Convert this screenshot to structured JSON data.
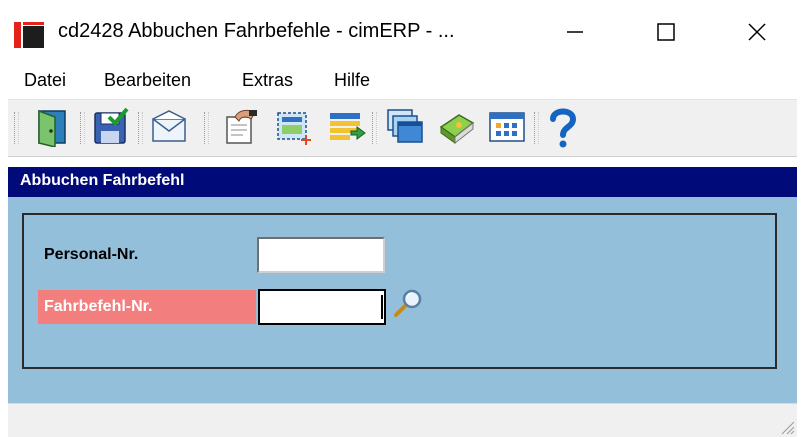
{
  "window": {
    "title": "cd2428 Abbuchen Fahrbefehle - cimERP - ...",
    "app_icon": "cimerp-app-icon",
    "controls": {
      "minimize": "minimize-icon",
      "maximize": "maximize-icon",
      "close": "close-icon"
    }
  },
  "menu": {
    "items": [
      {
        "label": "Datei"
      },
      {
        "label": "Bearbeiten"
      },
      {
        "label": "Extras"
      },
      {
        "label": "Hilfe"
      }
    ]
  },
  "toolbar": {
    "buttons": [
      {
        "icon": "exit-door-icon"
      },
      {
        "icon": "save-floppy-icon"
      },
      {
        "icon": "envelope-icon"
      },
      {
        "icon": "edit-document-icon"
      },
      {
        "icon": "new-record-icon"
      },
      {
        "icon": "import-list-icon"
      },
      {
        "icon": "windows-stack-icon"
      },
      {
        "icon": "book-icon"
      },
      {
        "icon": "calendar-grid-icon"
      },
      {
        "icon": "help-question-icon"
      }
    ]
  },
  "form": {
    "header": "Abbuchen Fahrbefehl",
    "fields": {
      "personal_nr": {
        "label": "Personal-Nr.",
        "value": ""
      },
      "fahrbefehl_nr": {
        "label": "Fahrbefehl-Nr.",
        "value": "",
        "state": "required"
      }
    },
    "lookup_icon": "magnifier-icon"
  },
  "colors": {
    "header_bg": "#000a78",
    "panel_bg": "#93bfda",
    "required_label_bg": "#f27e7e"
  }
}
